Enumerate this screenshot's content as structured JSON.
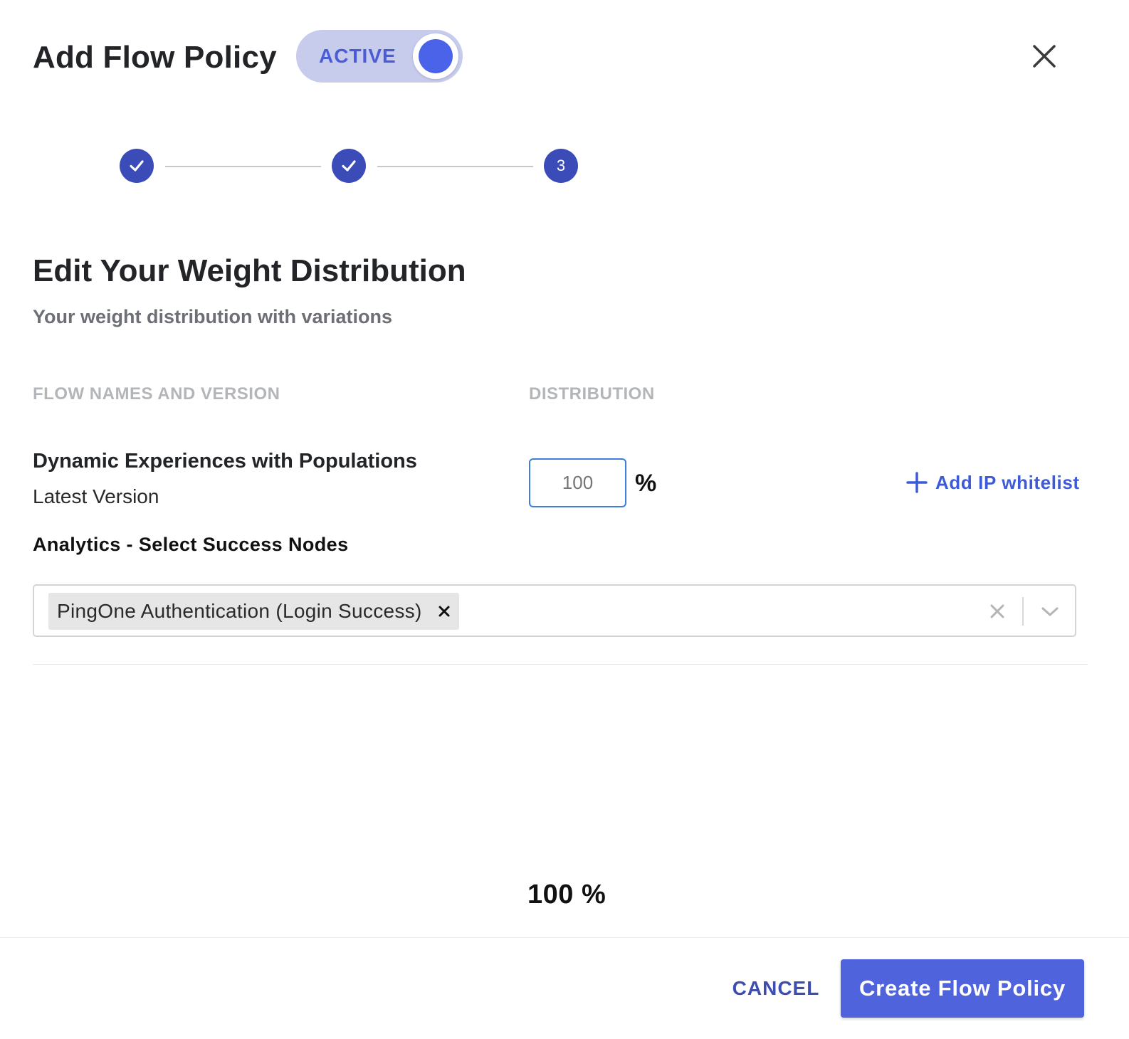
{
  "header": {
    "title": "Add Flow Policy",
    "toggle_label": "ACTIVE"
  },
  "stepper": {
    "steps": [
      {
        "state": "complete",
        "icon": "check-icon"
      },
      {
        "state": "complete",
        "icon": "check-icon"
      },
      {
        "state": "current",
        "label": "3"
      }
    ]
  },
  "section": {
    "title": "Edit Your Weight Distribution",
    "subtitle": "Your weight distribution with variations"
  },
  "columns": {
    "flow_header": "FLOW NAMES AND VERSION",
    "distribution_header": "DISTRIBUTION"
  },
  "flow": {
    "name": "Dynamic Experiences with Populations",
    "version": "Latest Version",
    "distribution_placeholder": "100",
    "percent_sign": "%",
    "add_ip_label": "Add IP whitelist"
  },
  "analytics": {
    "label": "Analytics - Select Success Nodes",
    "selected": [
      "PingOne Authentication (Login Success)"
    ]
  },
  "total": {
    "text": "100 %"
  },
  "footer": {
    "cancel_label": "CANCEL",
    "create_label": "Create Flow Policy"
  },
  "colors": {
    "primary": "#4f63dc",
    "step": "#3b4bb8",
    "toggle_track": "#c7cbec",
    "toggle_knob": "#4b63e8",
    "link": "#3d5bd6",
    "input_border": "#3d7ddb"
  }
}
